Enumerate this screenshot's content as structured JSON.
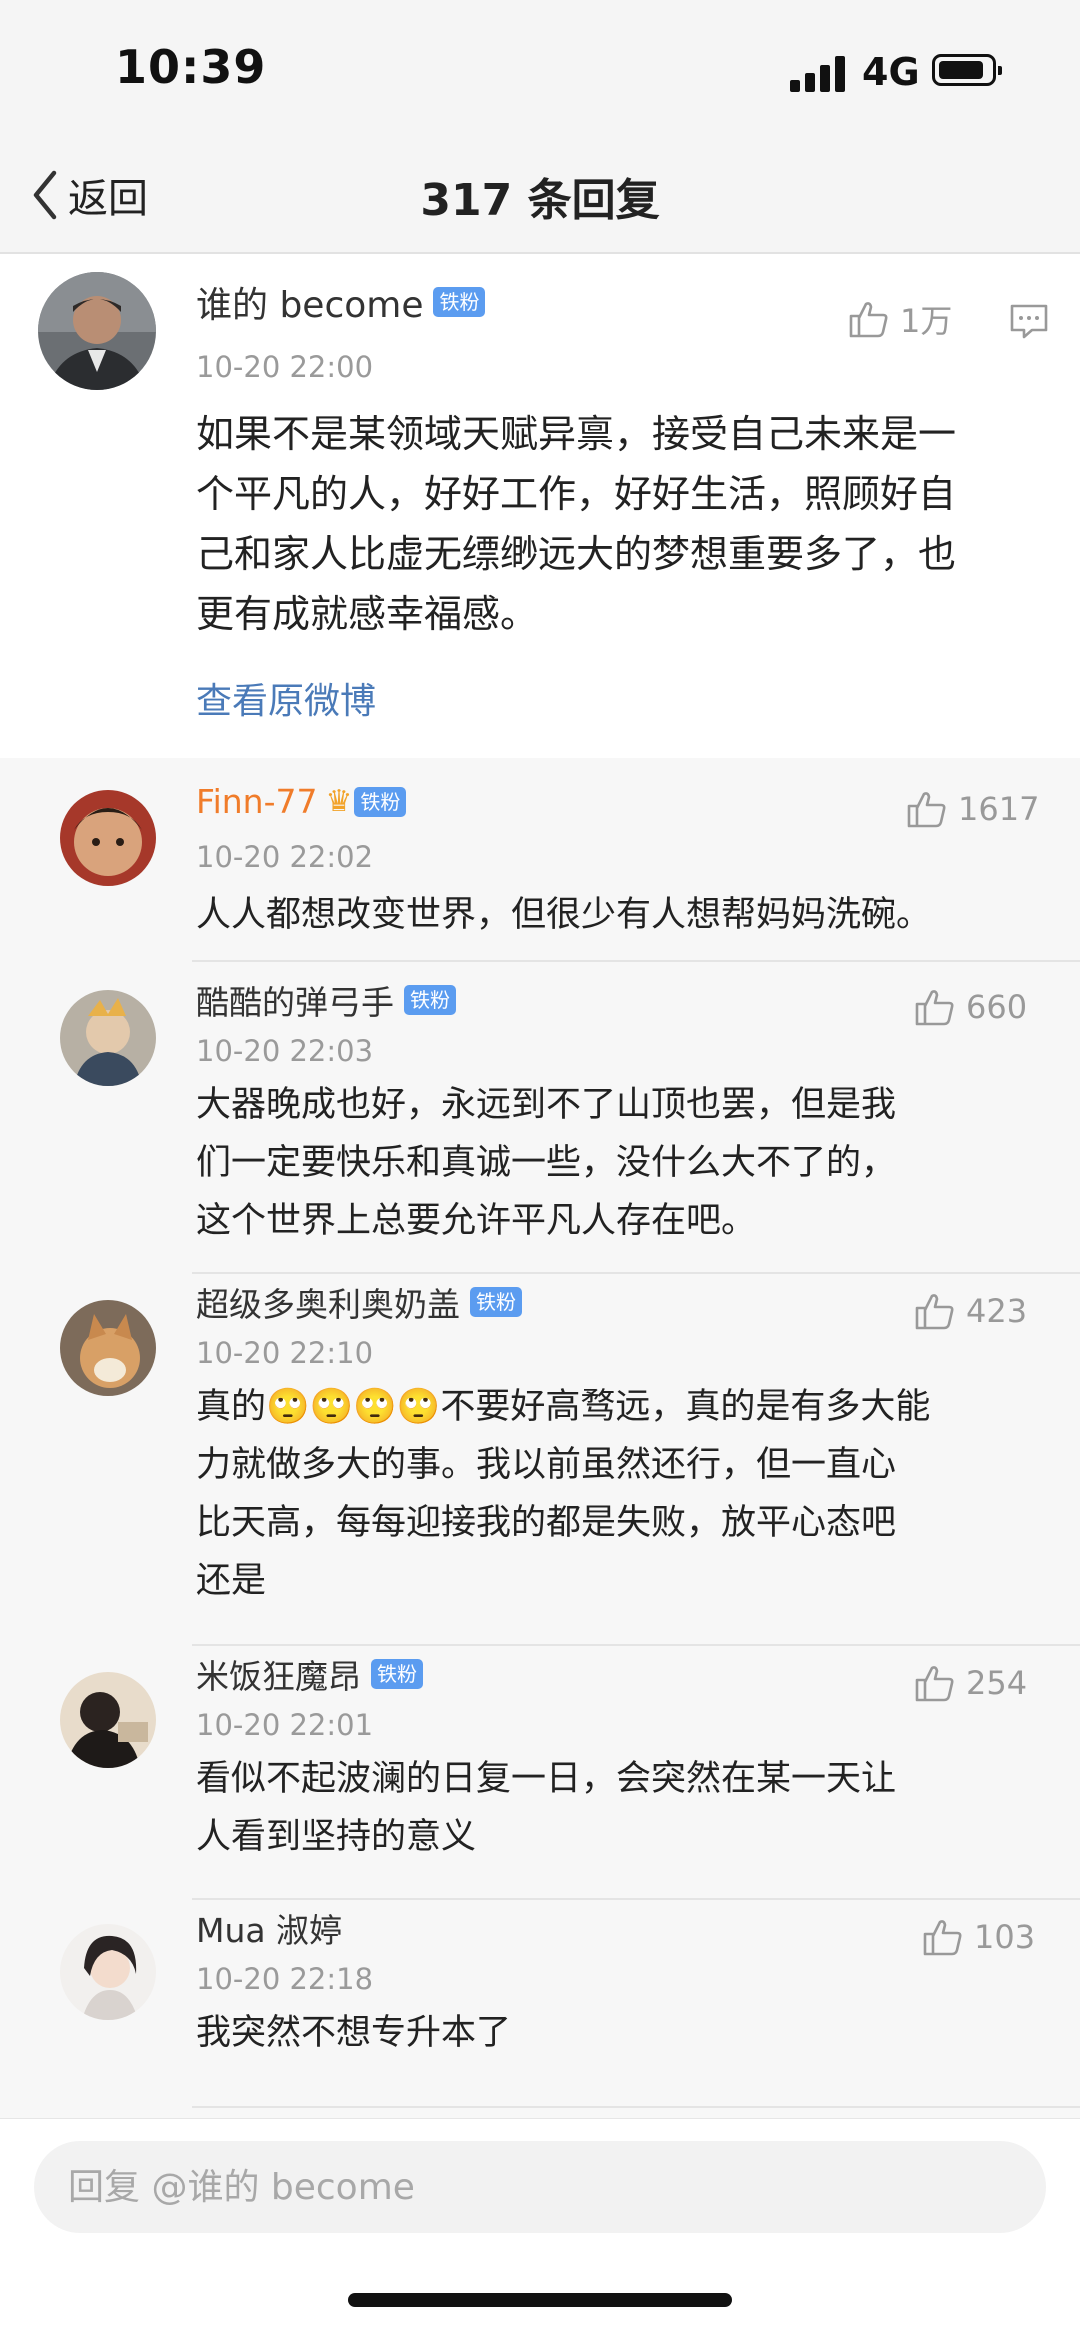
{
  "status_bar": {
    "time": "10:39",
    "network": "4G"
  },
  "nav": {
    "back_label": "返回",
    "title": "317 条回复"
  },
  "root_comment": {
    "username": "谁的 become",
    "badge": "铁粉",
    "timestamp": "10-20 22:00",
    "likes": "1万",
    "text_lines": [
      "如果不是某领域天赋异禀，接受自己未来是一",
      "个平凡的人，好好工作，好好生活，照顾好自",
      "己和家人比虚无缥缈远大的梦想重要多了，也",
      "更有成就感幸福感。"
    ],
    "view_original_label": "查看原微博"
  },
  "replies": [
    {
      "username": "Finn-77",
      "badge": "铁粉",
      "timestamp": "10-20 22:02",
      "likes": "1617",
      "text_lines": [
        "人人都想改变世界，但很少有人想帮妈妈洗碗。"
      ]
    },
    {
      "username": "酷酷的弹弓手",
      "badge": "铁粉",
      "timestamp": "10-20 22:03",
      "likes": "660",
      "text_lines": [
        "大器晚成也好，永远到不了山顶也罢，但是我",
        "们一定要快乐和真诚一些，没什么大不了的，",
        "这个世界上总要允许平凡人存在吧。"
      ]
    },
    {
      "username": "超级多奥利奥奶盖",
      "badge": "铁粉",
      "timestamp": "10-20 22:10",
      "likes": "423",
      "text_lines": [
        "真的🙄🙄🙄🙄不要好高骛远，真的是有多大能",
        "力就做多大的事。我以前虽然还行，但一直心",
        "比天高，每每迎接我的都是失败，放平心态吧",
        "还是"
      ]
    },
    {
      "username": "米饭狂魔昂",
      "badge": "铁粉",
      "timestamp": "10-20 22:01",
      "likes": "254",
      "text_lines": [
        "看似不起波澜的日复一日，会突然在某一天让",
        "人看到坚持的意义"
      ]
    },
    {
      "username": "Mua 淑婷",
      "timestamp": "10-20 22:18",
      "likes": "103",
      "text_lines": [
        "我突然不想专升本了"
      ]
    }
  ],
  "input": {
    "placeholder": "回复 @谁的 become"
  },
  "colors": {
    "link": "#4a7ab8",
    "badge": "#5b9cf0",
    "highlight_name": "#f07c2a",
    "meta": "#9a9a9a"
  }
}
